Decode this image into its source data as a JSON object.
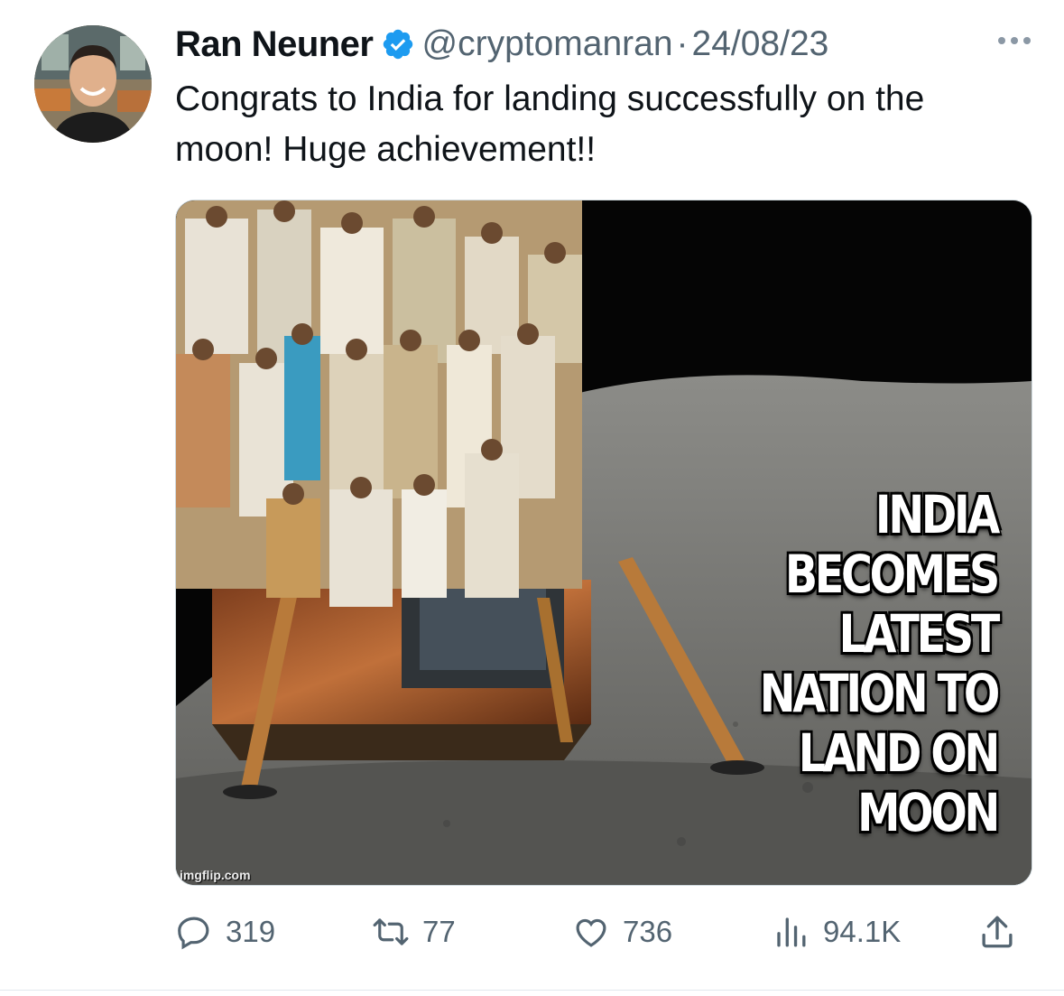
{
  "author": {
    "name": "Ran Neuner",
    "handle": "@cryptomanran",
    "separator": "·",
    "date": "24/08/23",
    "verified": true
  },
  "tweet": {
    "text": "Congrats to India for landing successfully on the moon! Huge achievement!!"
  },
  "media": {
    "caption_lines": [
      "INDIA",
      "BECOMES",
      "LATEST",
      "NATION TO",
      "LAND ON MOON"
    ],
    "watermark": "imgflip.com"
  },
  "actions": {
    "replies": "319",
    "retweets": "77",
    "likes": "736",
    "views": "94.1K"
  },
  "icons": {
    "verified": "verified-badge-icon",
    "more": "more-dots-icon",
    "reply": "reply-icon",
    "retweet": "retweet-icon",
    "like": "heart-icon",
    "views": "views-chart-icon",
    "share": "share-icon"
  },
  "colors": {
    "accent": "#1d9bf0",
    "text": "#0f1419",
    "secondary": "#536471"
  }
}
